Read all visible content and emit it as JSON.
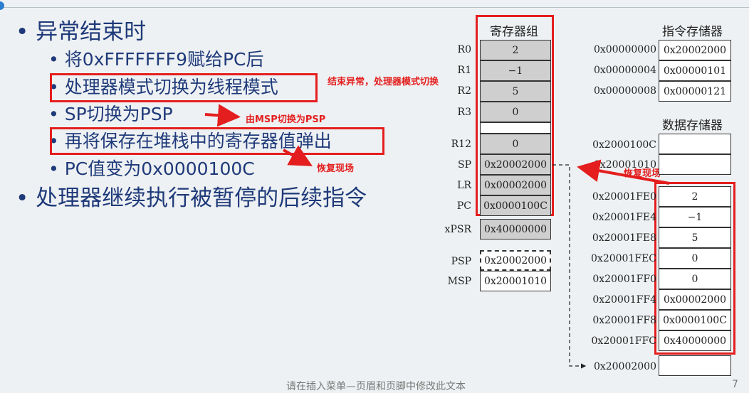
{
  "slide": {
    "bullets": [
      {
        "text": "异常结束时"
      },
      {
        "text": "将0xFFFFFFF9赋给PC后"
      },
      {
        "text": "处理器模式切换为线程模式"
      },
      {
        "text": "SP切换为PSP"
      },
      {
        "text": "再将保存在堆栈中的寄存器值弹出"
      },
      {
        "text": "PC值变为0x0000100C"
      },
      {
        "text": "处理器继续执行被暂停的后续指令"
      }
    ],
    "annotations": {
      "mode_switch": "结束异常，处理器模式切换",
      "sp_switch": "由MSP切换为PSP",
      "restore1": "恢复现场",
      "restore2": "恢复现场"
    },
    "footer": "请在插入菜单—页眉和页脚中修改此文本",
    "page_number": "7"
  },
  "registers": {
    "title": "寄存器组",
    "rows": [
      {
        "label": "R0",
        "value": "2"
      },
      {
        "label": "R1",
        "value": "−1"
      },
      {
        "label": "R2",
        "value": "5"
      },
      {
        "label": "R3",
        "value": "0"
      },
      {
        "label": "R12",
        "value": "0"
      },
      {
        "label": "SP",
        "value": "0x20002000"
      },
      {
        "label": "LR",
        "value": "0x00002000"
      },
      {
        "label": "PC",
        "value": "0x0000100C"
      },
      {
        "label": "xPSR",
        "value": "0x40000000"
      },
      {
        "label": "PSP",
        "value": "0x20002000"
      },
      {
        "label": "MSP",
        "value": "0x20001010"
      }
    ]
  },
  "instruction_memory": {
    "title": "指令存储器",
    "rows": [
      {
        "addr": "0x00000000",
        "value": "0x20002000"
      },
      {
        "addr": "0x00000004",
        "value": "0x00000101"
      },
      {
        "addr": "0x00000008",
        "value": "0x00000121"
      }
    ]
  },
  "data_memory": {
    "title": "数据存储器",
    "rows": [
      {
        "addr": "0x2000100C",
        "value": ""
      },
      {
        "addr": "0x20001010",
        "value": ""
      },
      {
        "addr": "0x20001FE0",
        "value": "2"
      },
      {
        "addr": "0x20001FE4",
        "value": "−1"
      },
      {
        "addr": "0x20001FE8",
        "value": "5"
      },
      {
        "addr": "0x20001FEC",
        "value": "0"
      },
      {
        "addr": "0x20001FF0",
        "value": "0"
      },
      {
        "addr": "0x20001FF4",
        "value": "0x00002000"
      },
      {
        "addr": "0x20001FF8",
        "value": "0x0000100C"
      },
      {
        "addr": "0x20001FFC",
        "value": "0x40000000"
      },
      {
        "addr": "0x20002000",
        "value": ""
      }
    ]
  },
  "colors": {
    "accent_red": "#e41e1e",
    "text_blue": "#1f3a7a",
    "register_fill": "#cfcfcf"
  }
}
